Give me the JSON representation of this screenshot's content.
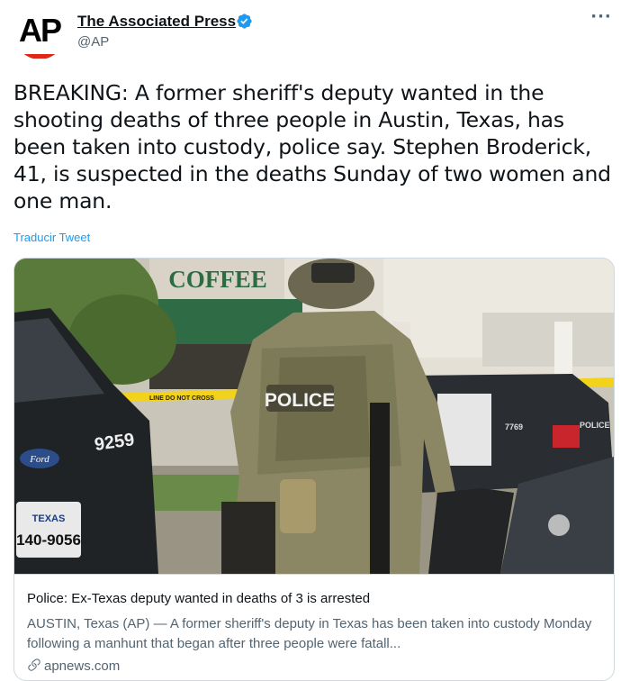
{
  "account": {
    "name": "The Associated Press",
    "handle": "@AP",
    "avatar_text": "AP"
  },
  "tweet": {
    "text": "BREAKING: A former sheriff's deputy wanted in the shooting deaths of three people in Austin, Texas, has been taken into custody, police say. Stephen Broderick, 41, is suspected in the deaths Sunday of two women and one man.",
    "translate_label": "Traducir Tweet"
  },
  "card": {
    "title": "Police: Ex-Texas deputy wanted in deaths of 3 is arrested",
    "description": "AUSTIN, Texas (AP) — A former sheriff's deputy in Texas has been taken into custody Monday following a manhunt that began after three people were fatall...",
    "domain": "apnews.com",
    "photo": {
      "sign_text": "COFFEE",
      "vest_text": "POLICE",
      "car_number": "9259",
      "plate_state": "TEXAS",
      "plate_number": "140-9056",
      "badge_text": "Ford",
      "car2_number": "7769",
      "car2_text": "POLICE",
      "tape_text": "LINE DO NOT CROSS"
    }
  },
  "colors": {
    "accent": "#1d9bf0",
    "ap_red": "#e0261a",
    "text_primary": "#0f1419",
    "text_secondary": "#536471"
  }
}
